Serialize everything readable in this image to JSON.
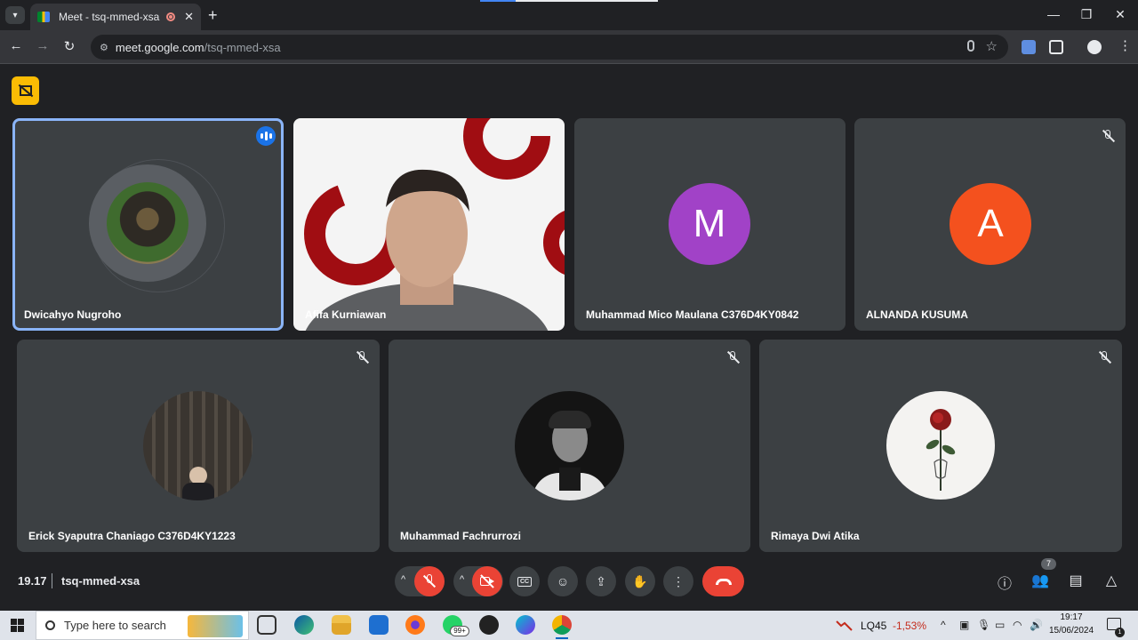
{
  "browser": {
    "tab_title": "Meet - tsq-mmed-xsa",
    "url_host": "meet.google.com",
    "url_path": "/tsq-mmed-xsa",
    "new_tab": "+",
    "minimize": "—",
    "maximize": "❐",
    "close": "✕"
  },
  "meet": {
    "time": "19.17",
    "meeting_code": "tsq-mmed-xsa",
    "people_count": "7",
    "participants": [
      {
        "name": "Dwicahyo Nugroho",
        "muted": false,
        "speaking": true,
        "avatar": "photo"
      },
      {
        "name": "Afifa Kurniawan",
        "muted": false,
        "speaking": false,
        "avatar": "video"
      },
      {
        "name": "Muhammad Mico Maulana C376D4KY0842",
        "muted": false,
        "speaking": false,
        "avatar_letter": "M",
        "avatar_color": "#a142c7"
      },
      {
        "name": "ALNANDA KUSUMA",
        "muted": true,
        "speaking": false,
        "avatar_letter": "A",
        "avatar_color": "#f4511e"
      },
      {
        "name": "Erick Syaputra Chaniago C376D4KY1223",
        "muted": true,
        "speaking": false,
        "avatar": "photo"
      },
      {
        "name": "Muhammad Fachrurrozi",
        "muted": true,
        "speaking": false,
        "avatar": "photo"
      },
      {
        "name": "Rimaya Dwi Atika",
        "muted": true,
        "speaking": false,
        "avatar": "photo"
      }
    ],
    "colors": {
      "accent": "#8ab4f8",
      "danger": "#ea4335",
      "tile": "#3c4043",
      "background": "#202124"
    }
  },
  "taskbar": {
    "search_placeholder": "Type here to search",
    "whatsapp_badge": "99+",
    "stock_ticker": "LQ45",
    "stock_change": "-1,53%",
    "clock_time": "19:17",
    "clock_date": "15/06/2024",
    "notification_count": "1"
  }
}
